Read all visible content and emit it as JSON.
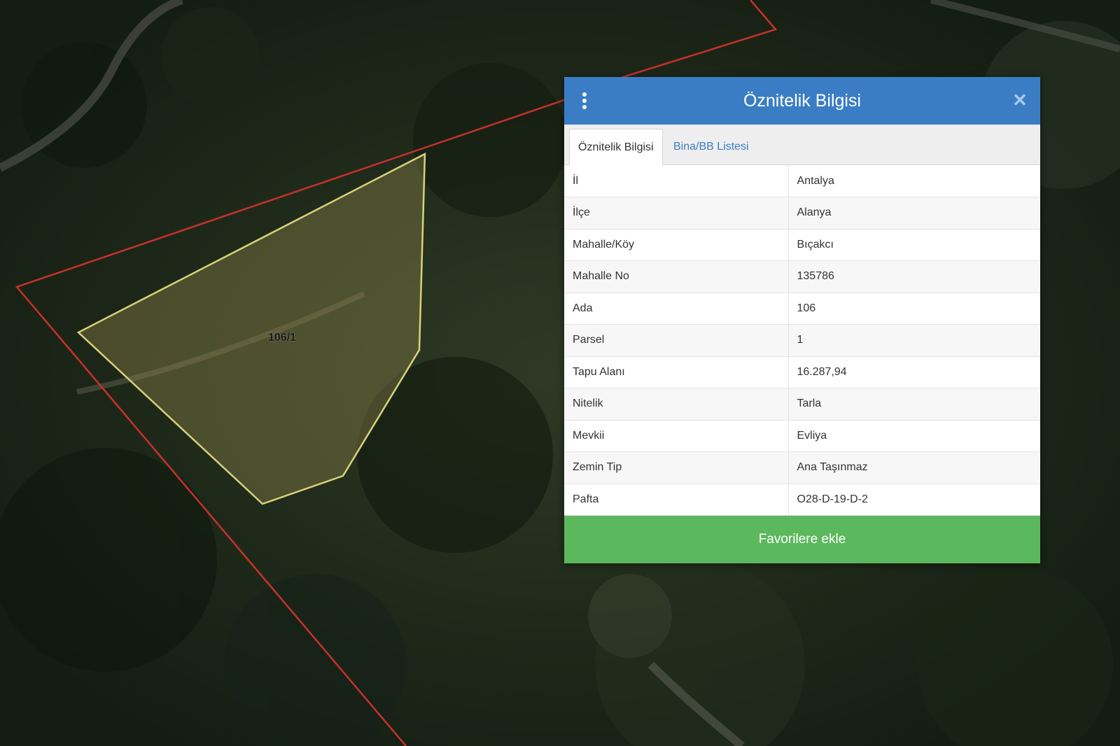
{
  "map": {
    "parcel_label": "106/1"
  },
  "panel": {
    "title": "Öznitelik Bilgisi",
    "tabs": [
      {
        "label": "Öznitelik Bilgisi",
        "active": true
      },
      {
        "label": "Bina/BB Listesi",
        "active": false
      }
    ],
    "rows": [
      {
        "key": "İl",
        "value": "Antalya"
      },
      {
        "key": "İlçe",
        "value": "Alanya"
      },
      {
        "key": "Mahalle/Köy",
        "value": "Bıçakcı"
      },
      {
        "key": "Mahalle No",
        "value": "135786"
      },
      {
        "key": "Ada",
        "value": "106"
      },
      {
        "key": "Parsel",
        "value": "1"
      },
      {
        "key": "Tapu Alanı",
        "value": "16.287,94"
      },
      {
        "key": "Nitelik",
        "value": "Tarla"
      },
      {
        "key": "Mevkii",
        "value": "Evliya"
      },
      {
        "key": "Zemin Tip",
        "value": "Ana Taşınmaz"
      },
      {
        "key": "Pafta",
        "value": "O28-D-19-D-2"
      }
    ],
    "favorite_label": "Favorilere ekle"
  },
  "colors": {
    "header": "#3a7dc4",
    "button": "#5cb85c",
    "boundary": "#c8302c",
    "parcel": "#d8d27a"
  }
}
